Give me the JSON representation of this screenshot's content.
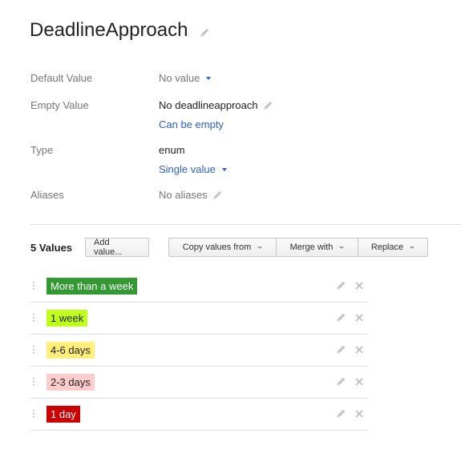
{
  "header": {
    "title": "DeadlineApproach",
    "edit_icon": "pencil-icon"
  },
  "properties": {
    "default_value": {
      "label": "Default Value",
      "value": "No value",
      "icon": "caret-down-icon"
    },
    "empty_value": {
      "label": "Empty Value",
      "value": "No deadlineapproach",
      "link": "Can be empty",
      "icon": "pencil-icon"
    },
    "type": {
      "label": "Type",
      "value": "enum",
      "link": "Single value",
      "icon": "caret-down-icon"
    },
    "aliases": {
      "label": "Aliases",
      "value": "No aliases",
      "icon": "pencil-icon"
    }
  },
  "toolbar": {
    "count_label": "5 Values",
    "add_value": "Add value...",
    "copy_values_from": "Copy values from",
    "merge_with": "Merge with",
    "replace": "Replace"
  },
  "values": [
    {
      "label": "More than a week",
      "bg": "#339933",
      "fg": "#ffffff"
    },
    {
      "label": "1 week",
      "bg": "#bfff1c",
      "fg": "#222222"
    },
    {
      "label": "4-6 days",
      "bg": "#ffee7a",
      "fg": "#222222"
    },
    {
      "label": "2-3 days",
      "bg": "#ffcccc",
      "fg": "#222222"
    },
    {
      "label": "1 day",
      "bg": "#cc0000",
      "fg": "#ffffff"
    }
  ],
  "colors": {
    "link": "#2f5fc8",
    "label_grey": "#777777",
    "divider": "#dddddd"
  }
}
